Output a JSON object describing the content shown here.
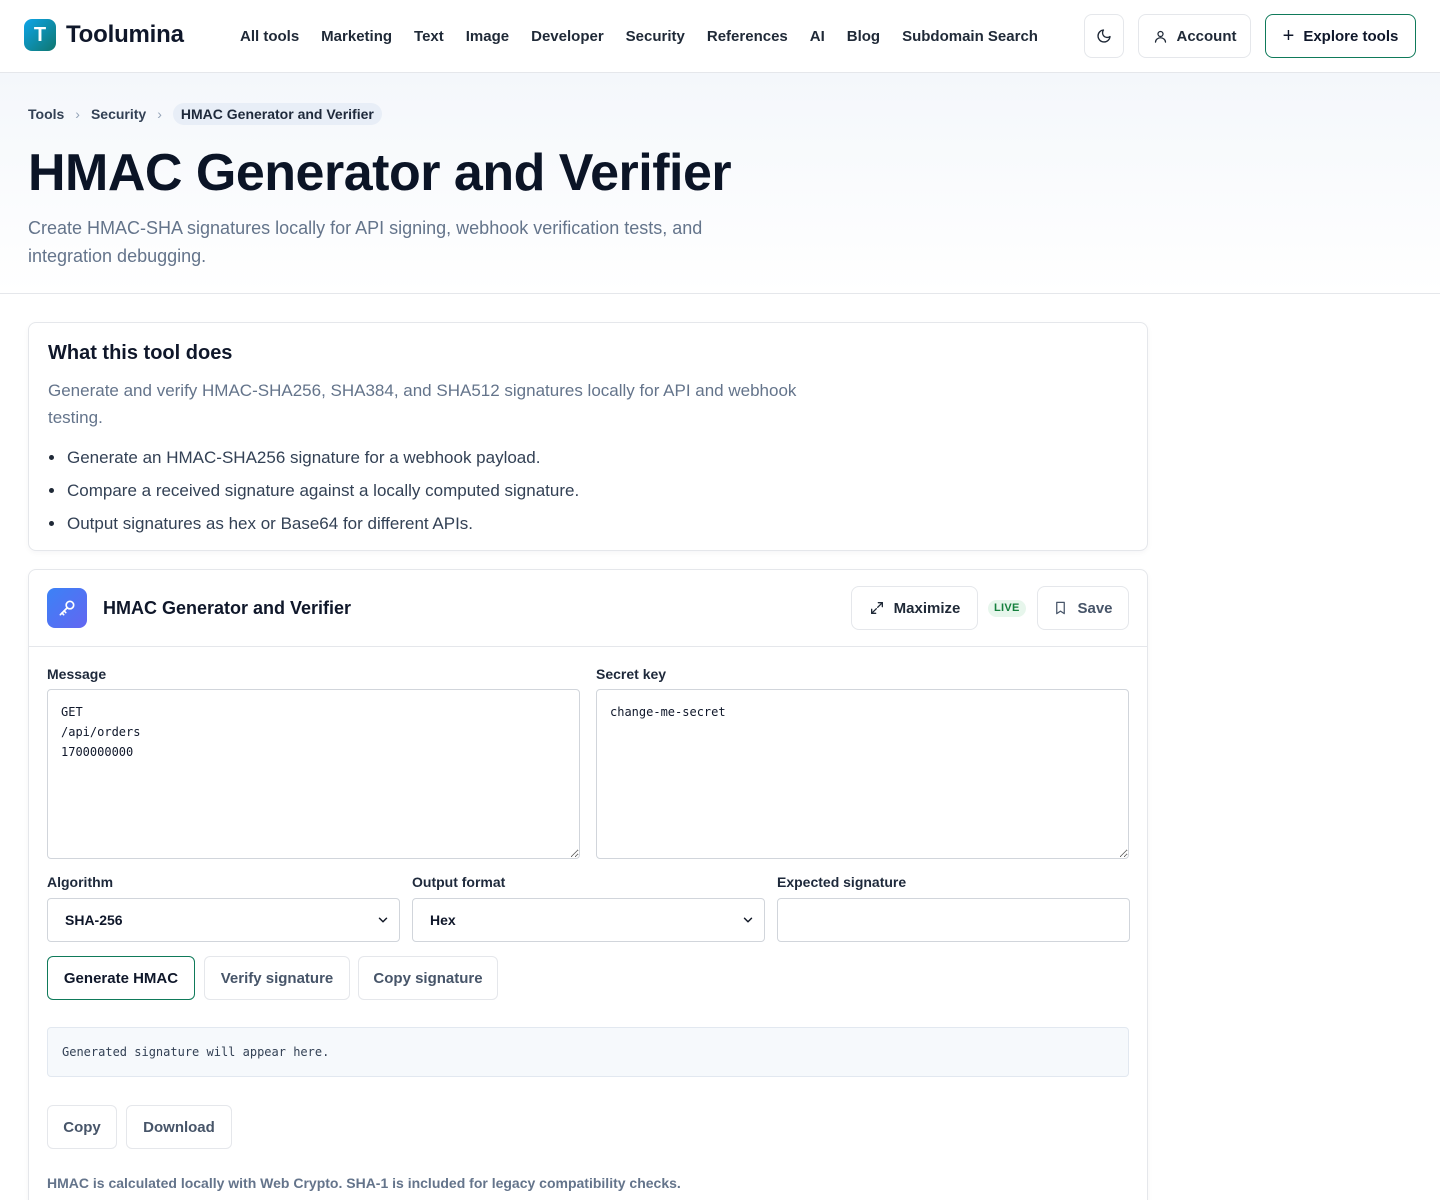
{
  "brand": {
    "logo_letter": "T",
    "name": "Toolumina"
  },
  "nav": [
    {
      "label": "All tools"
    },
    {
      "label": "Marketing"
    },
    {
      "label": "Text"
    },
    {
      "label": "Image"
    },
    {
      "label": "Developer"
    },
    {
      "label": "Security"
    },
    {
      "label": "References"
    },
    {
      "label": "AI"
    },
    {
      "label": "Blog"
    },
    {
      "label": "Subdomain Search"
    }
  ],
  "header_actions": {
    "account_label": "Account",
    "explore_label": "Explore tools"
  },
  "breadcrumb": {
    "items": [
      "Tools",
      "Security"
    ],
    "current": "HMAC Generator and Verifier"
  },
  "page": {
    "title": "HMAC Generator and Verifier",
    "subtitle": "Create HMAC-SHA signatures locally for API signing, webhook verification tests, and integration debugging."
  },
  "about": {
    "heading": "What this tool does",
    "description": "Generate and verify HMAC-SHA256, SHA384, and SHA512 signatures locally for API and webhook testing.",
    "bullets": [
      "Generate an HMAC-SHA256 signature for a webhook payload.",
      "Compare a received signature against a locally computed signature.",
      "Output signatures as hex or Base64 for different APIs."
    ]
  },
  "tool": {
    "title": "HMAC Generator and Verifier",
    "maximize_label": "Maximize",
    "live_badge": "LIVE",
    "save_label": "Save",
    "message_label": "Message",
    "message_value": "GET\n/api/orders\n1700000000",
    "secret_label": "Secret key",
    "secret_value": "change-me-secret",
    "algorithm_label": "Algorithm",
    "algorithm_value": "SHA-256",
    "format_label": "Output format",
    "format_value": "Hex",
    "expected_label": "Expected signature",
    "expected_value": "",
    "generate_label": "Generate HMAC",
    "verify_label": "Verify signature",
    "copy_signature_label": "Copy signature",
    "output_placeholder": "Generated signature will appear here.",
    "copy_label": "Copy",
    "download_label": "Download",
    "note": "HMAC is calculated locally with Web Crypto. SHA-1 is included for legacy compatibility checks."
  },
  "colors": {
    "accent": "#0f7a5a",
    "live_badge_bg": "#e7f6ec",
    "live_badge_text": "#15803d",
    "tool_icon": "#4f6cf5"
  },
  "icons": [
    "moon-icon",
    "user-icon",
    "plus-icon",
    "chevron-right-icon",
    "key-icon",
    "maximize-icon",
    "bookmark-icon",
    "chevron-down-icon"
  ]
}
